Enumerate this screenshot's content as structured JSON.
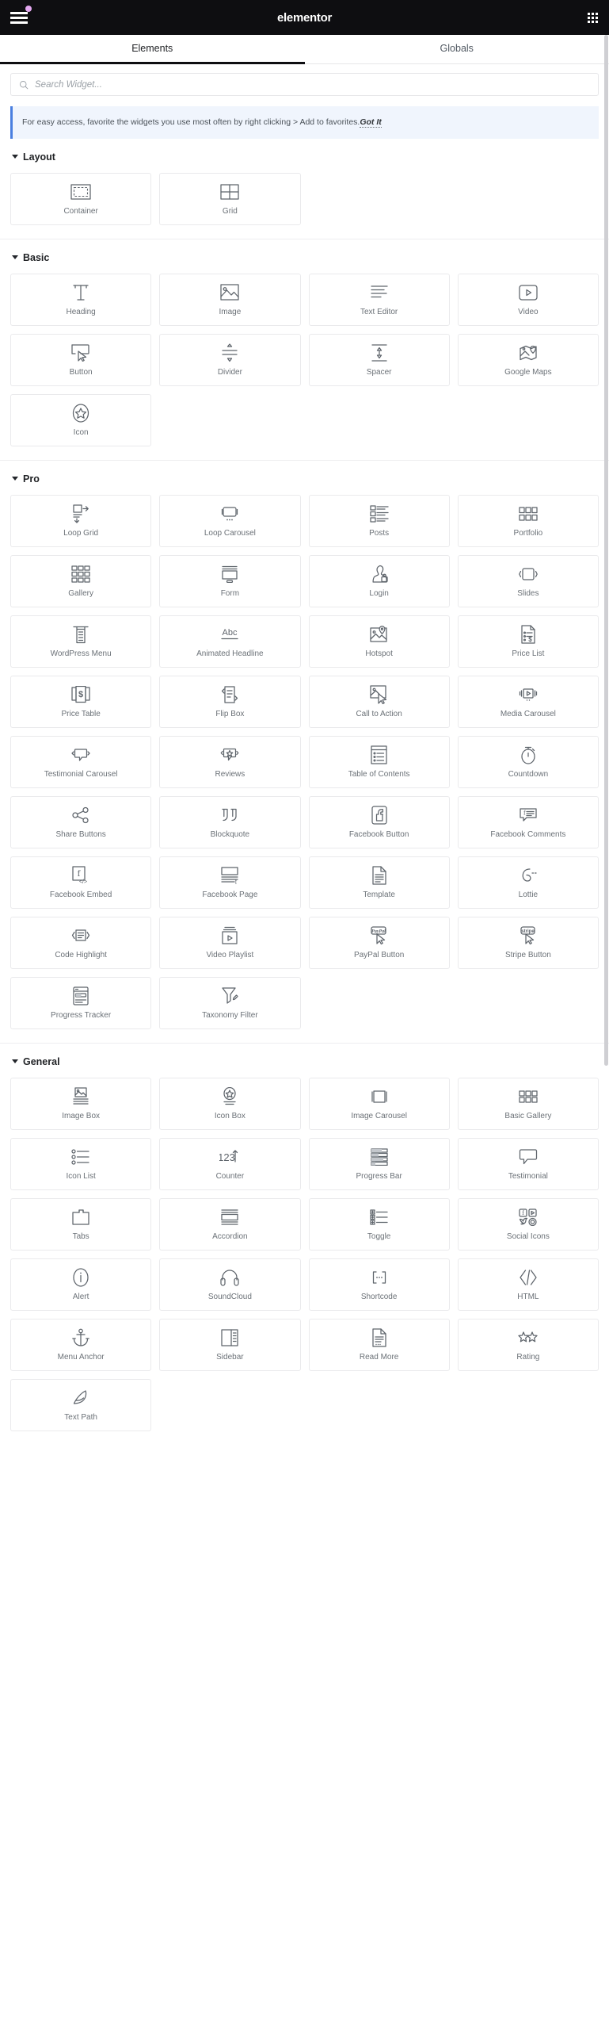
{
  "topbar": {
    "menu_icon": "hamburger-menu-icon",
    "badge": "notification-dot",
    "brand": "elementor",
    "apps_icon": "app-grid-icon"
  },
  "tabs": [
    {
      "label": "Elements",
      "active": true
    },
    {
      "label": "Globals",
      "active": false
    }
  ],
  "search": {
    "icon": "search-icon",
    "placeholder": "Search Widget...",
    "value": ""
  },
  "notice": {
    "text": "For easy access, favorite the widgets you use most often by right clicking > Add to favorites.",
    "action_label": "Got It",
    "accent_color": "#4a7fe0",
    "background": "#f0f5fd"
  },
  "sections": [
    {
      "title": "Layout",
      "collapsed": false,
      "widgets": [
        {
          "label": "Container",
          "icon": "container-icon"
        },
        {
          "label": "Grid",
          "icon": "grid-icon"
        }
      ]
    },
    {
      "title": "Basic",
      "collapsed": false,
      "widgets": [
        {
          "label": "Heading",
          "icon": "heading-icon"
        },
        {
          "label": "Image",
          "icon": "image-icon"
        },
        {
          "label": "Text Editor",
          "icon": "text-editor-icon"
        },
        {
          "label": "Video",
          "icon": "video-icon"
        },
        {
          "label": "Button",
          "icon": "button-icon"
        },
        {
          "label": "Divider",
          "icon": "divider-icon"
        },
        {
          "label": "Spacer",
          "icon": "spacer-icon"
        },
        {
          "label": "Google Maps",
          "icon": "google-maps-icon"
        },
        {
          "label": "Icon",
          "icon": "star-icon"
        }
      ]
    },
    {
      "title": "Pro",
      "collapsed": false,
      "widgets": [
        {
          "label": "Loop Grid",
          "icon": "loop-grid-icon"
        },
        {
          "label": "Loop Carousel",
          "icon": "loop-carousel-icon"
        },
        {
          "label": "Posts",
          "icon": "posts-icon"
        },
        {
          "label": "Portfolio",
          "icon": "portfolio-icon"
        },
        {
          "label": "Gallery",
          "icon": "gallery-icon"
        },
        {
          "label": "Form",
          "icon": "form-icon"
        },
        {
          "label": "Login",
          "icon": "login-icon"
        },
        {
          "label": "Slides",
          "icon": "slides-icon"
        },
        {
          "label": "WordPress Menu",
          "icon": "wordpress-menu-icon"
        },
        {
          "label": "Animated Headline",
          "icon": "animated-headline-icon"
        },
        {
          "label": "Hotspot",
          "icon": "hotspot-icon"
        },
        {
          "label": "Price List",
          "icon": "price-list-icon"
        },
        {
          "label": "Price Table",
          "icon": "price-table-icon"
        },
        {
          "label": "Flip Box",
          "icon": "flip-box-icon"
        },
        {
          "label": "Call to Action",
          "icon": "call-to-action-icon"
        },
        {
          "label": "Media Carousel",
          "icon": "media-carousel-icon"
        },
        {
          "label": "Testimonial Carousel",
          "icon": "testimonial-carousel-icon"
        },
        {
          "label": "Reviews",
          "icon": "reviews-icon"
        },
        {
          "label": "Table of Contents",
          "icon": "table-of-contents-icon"
        },
        {
          "label": "Countdown",
          "icon": "countdown-icon"
        },
        {
          "label": "Share Buttons",
          "icon": "share-buttons-icon"
        },
        {
          "label": "Blockquote",
          "icon": "blockquote-icon"
        },
        {
          "label": "Facebook Button",
          "icon": "facebook-button-icon"
        },
        {
          "label": "Facebook Comments",
          "icon": "facebook-comments-icon"
        },
        {
          "label": "Facebook Embed",
          "icon": "facebook-embed-icon"
        },
        {
          "label": "Facebook Page",
          "icon": "facebook-page-icon"
        },
        {
          "label": "Template",
          "icon": "template-icon"
        },
        {
          "label": "Lottie",
          "icon": "lottie-icon"
        },
        {
          "label": "Code Highlight",
          "icon": "code-highlight-icon"
        },
        {
          "label": "Video Playlist",
          "icon": "video-playlist-icon"
        },
        {
          "label": "PayPal Button",
          "icon": "paypal-button-icon"
        },
        {
          "label": "Stripe Button",
          "icon": "stripe-button-icon"
        },
        {
          "label": "Progress Tracker",
          "icon": "progress-tracker-icon"
        },
        {
          "label": "Taxonomy Filter",
          "icon": "taxonomy-filter-icon"
        }
      ]
    },
    {
      "title": "General",
      "collapsed": false,
      "widgets": [
        {
          "label": "Image Box",
          "icon": "image-box-icon"
        },
        {
          "label": "Icon Box",
          "icon": "icon-box-icon"
        },
        {
          "label": "Image Carousel",
          "icon": "image-carousel-icon"
        },
        {
          "label": "Basic Gallery",
          "icon": "basic-gallery-icon"
        },
        {
          "label": "Icon List",
          "icon": "icon-list-icon"
        },
        {
          "label": "Counter",
          "icon": "counter-icon"
        },
        {
          "label": "Progress Bar",
          "icon": "progress-bar-icon"
        },
        {
          "label": "Testimonial",
          "icon": "testimonial-icon"
        },
        {
          "label": "Tabs",
          "icon": "tabs-icon"
        },
        {
          "label": "Accordion",
          "icon": "accordion-icon"
        },
        {
          "label": "Toggle",
          "icon": "toggle-icon"
        },
        {
          "label": "Social Icons",
          "icon": "social-icons-icon"
        },
        {
          "label": "Alert",
          "icon": "alert-icon"
        },
        {
          "label": "SoundCloud",
          "icon": "soundcloud-icon"
        },
        {
          "label": "Shortcode",
          "icon": "shortcode-icon"
        },
        {
          "label": "HTML",
          "icon": "html-icon"
        },
        {
          "label": "Menu Anchor",
          "icon": "menu-anchor-icon"
        },
        {
          "label": "Sidebar",
          "icon": "sidebar-icon"
        },
        {
          "label": "Read More",
          "icon": "read-more-icon"
        },
        {
          "label": "Rating",
          "icon": "rating-icon"
        },
        {
          "label": "Text Path",
          "icon": "text-path-icon"
        }
      ]
    }
  ]
}
